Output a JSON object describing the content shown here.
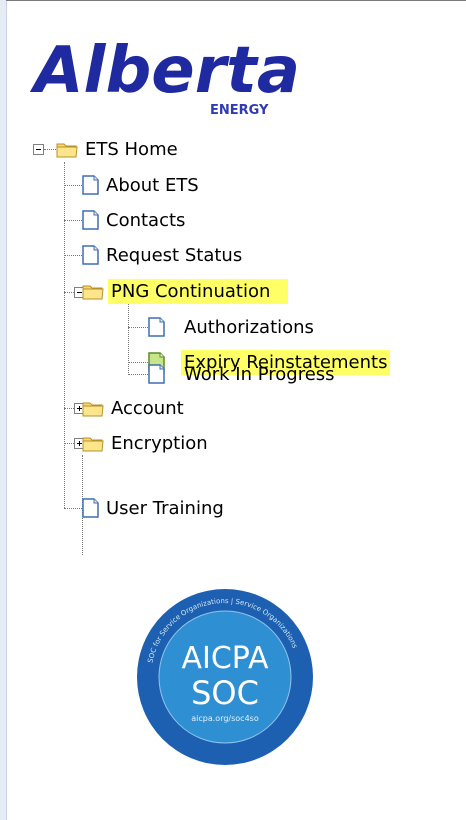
{
  "logo": {
    "brand": "Alberta",
    "sub": "ENERGY",
    "colors": {
      "brand": "#1f2aa0",
      "sub": "#2f3bb5"
    }
  },
  "tree": {
    "root": {
      "label": "ETS Home",
      "expander": "minus"
    },
    "items": {
      "about": "About ETS",
      "contacts": "Contacts",
      "request_status": "Request Status",
      "png": "PNG Continuation",
      "authorizations": "Authorizations",
      "expiry": "Expiry Reinstatements",
      "wip": "Work In Progress",
      "account": "Account",
      "encryption": "Encryption",
      "user_training": "User Training"
    },
    "highlight_color": "#ffff66",
    "folder_color": "#f8d96b",
    "page_color": "#3d6fb6"
  },
  "badge": {
    "line1": "AICPA",
    "line2": "SOC",
    "url": "aicpa.org/soc4so",
    "ring_text": "SOC for Service Organizations | Service Organizations",
    "colors": {
      "outer": "#1d5fb0",
      "inner": "#2f8fd3",
      "text": "#ffffff"
    }
  }
}
